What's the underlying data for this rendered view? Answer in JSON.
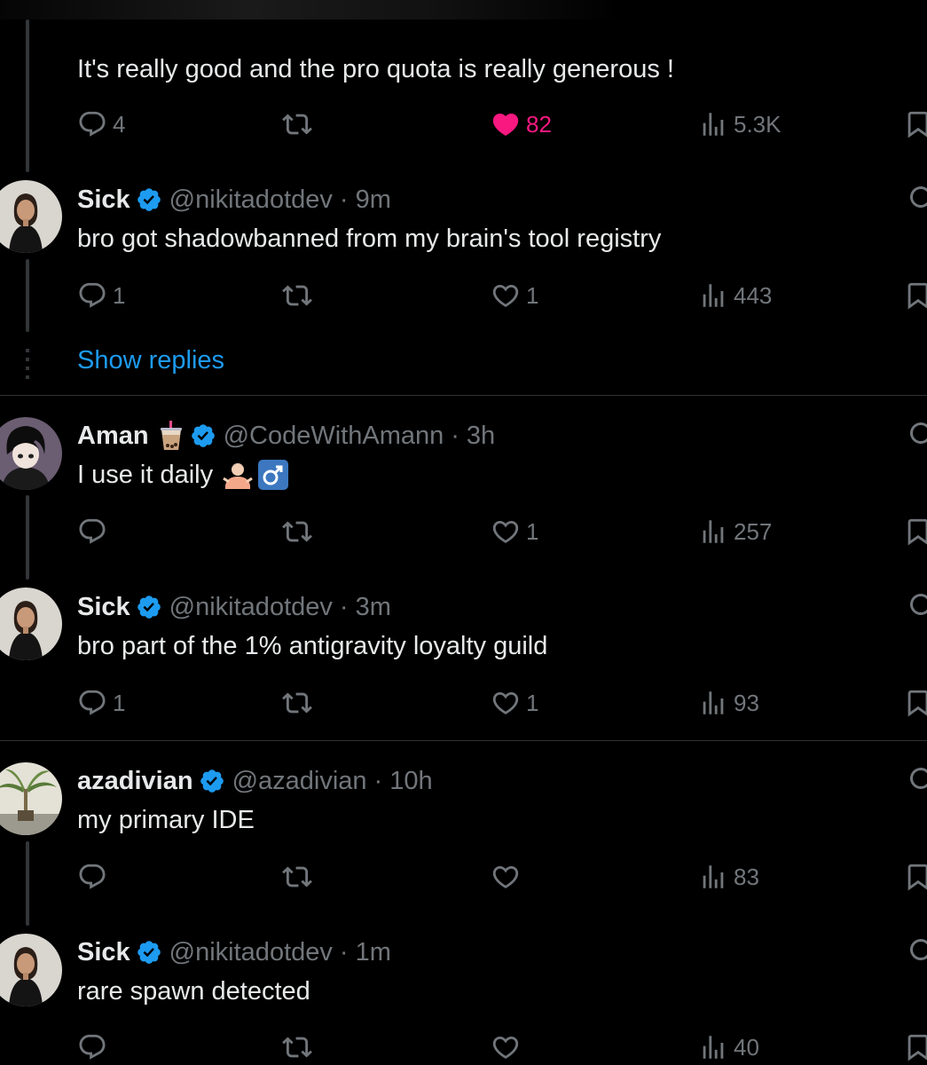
{
  "colors": {
    "background": "#000000",
    "text": "#e7e9ea",
    "muted": "#71767b",
    "accent": "#1d9bf0",
    "like": "#f91880",
    "divider": "#2f3336"
  },
  "top_post": {
    "text": "It's really good and the pro quota is really generous !",
    "replies": "4",
    "likes": "82",
    "views": "5.3K",
    "liked": true
  },
  "replies": [
    {
      "name": "Sick",
      "handle": "@nikitadotdev",
      "sep": "·",
      "time": "9m",
      "text": "bro got shadowbanned from my brain's tool registry",
      "replies": "1",
      "likes": "1",
      "views": "443",
      "avatar": "woman-avatar"
    },
    {
      "name": "Aman",
      "handle": "@CodeWithAmann",
      "sep": "·",
      "time": "3h",
      "text": "I use it daily",
      "emoji_name": "bubble-tea-emoji",
      "text_emoji": "man-shrugging-emoji",
      "replies": "",
      "likes": "1",
      "views": "257",
      "avatar": "anime-avatar"
    },
    {
      "name": "Sick",
      "handle": "@nikitadotdev",
      "sep": "·",
      "time": "3m",
      "text": "bro part of the 1% antigravity loyalty guild",
      "replies": "1",
      "likes": "1",
      "views": "93",
      "avatar": "woman-avatar"
    },
    {
      "name": "azadivian",
      "handle": "@azadivian",
      "sep": "·",
      "time": "10h",
      "text": "my primary IDE",
      "replies": "",
      "likes": "",
      "views": "83",
      "avatar": "palm-avatar"
    },
    {
      "name": "Sick",
      "handle": "@nikitadotdev",
      "sep": "·",
      "time": "1m",
      "text": "rare spawn detected",
      "replies": "",
      "likes": "",
      "views": "40",
      "avatar": "woman-avatar"
    }
  ],
  "show_replies": "Show replies",
  "icons": [
    "reply-icon",
    "retweet-icon",
    "like-icon",
    "views-icon",
    "bookmark-icon",
    "grok-icon",
    "verified-badge-icon"
  ]
}
